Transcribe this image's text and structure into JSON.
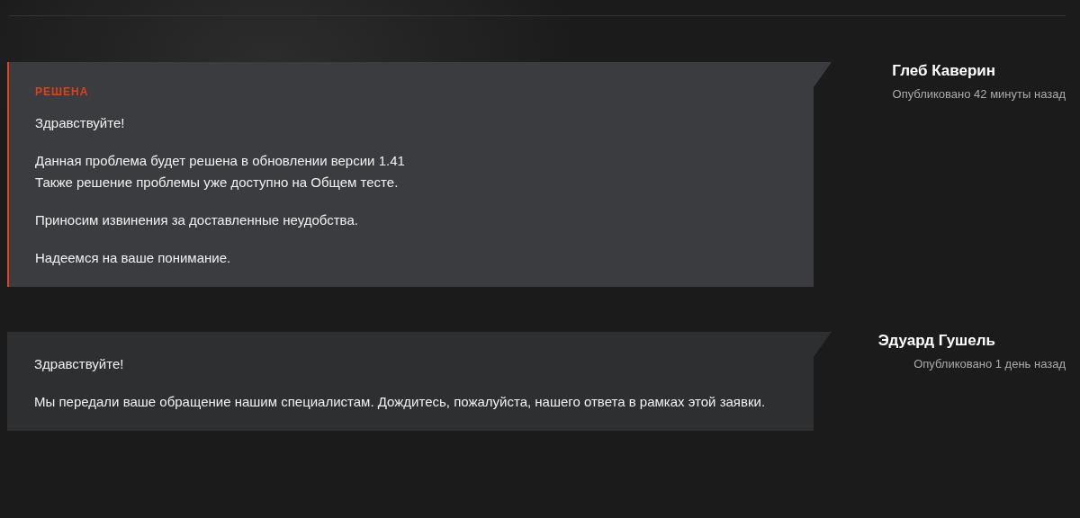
{
  "messages": [
    {
      "status": "РЕШЕНА",
      "resolved": true,
      "paragraphs": [
        [
          "Здравствуйте!"
        ],
        [
          "Данная проблема будет решена в обновлении версии 1.41",
          "Также решение проблемы уже доступно на Общем тесте."
        ],
        [
          "Приносим извинения за доставленные неудобства."
        ],
        [
          "Надеемся на ваше понимание."
        ]
      ],
      "author": "Глеб Каверин",
      "published": "Опубликовано 42 минуты назад"
    },
    {
      "resolved": false,
      "paragraphs": [
        [
          "Здравствуйте!"
        ],
        [
          "Мы передали ваше обращение нашим специалистам. Дождитесь, пожалуйста, нашего ответа в рамках этой заявки."
        ]
      ],
      "author": "Эдуард Гушель",
      "published": "Опубликовано 1 день назад"
    }
  ]
}
